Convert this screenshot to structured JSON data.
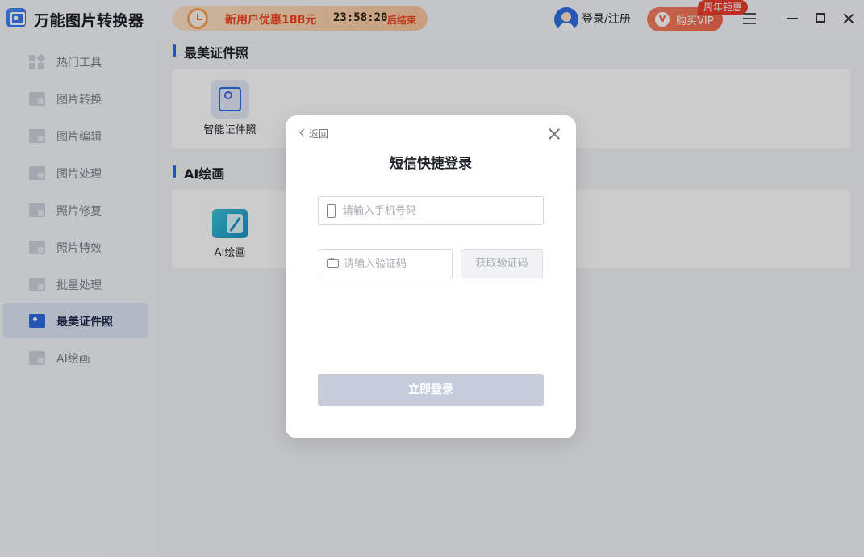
{
  "app": {
    "title": "万能图片转换器"
  },
  "promo": {
    "text": "新用户优惠188元",
    "timer": "23:58:20",
    "suffix": "后结束"
  },
  "header": {
    "login_label": "登录/注册",
    "vip_label": "购买VIP",
    "vip_badge": "周年钜惠"
  },
  "sidebar": {
    "items": [
      {
        "label": "热门工具",
        "icon": "grid-icon"
      },
      {
        "label": "图片转换",
        "icon": "image-convert-icon"
      },
      {
        "label": "图片编辑",
        "icon": "image-edit-icon"
      },
      {
        "label": "图片处理",
        "icon": "image-process-icon"
      },
      {
        "label": "照片修复",
        "icon": "photo-repair-icon"
      },
      {
        "label": "照片特效",
        "icon": "photo-effect-icon"
      },
      {
        "label": "批量处理",
        "icon": "batch-icon"
      },
      {
        "label": "最美证件照",
        "icon": "id-photo-icon",
        "active": true
      },
      {
        "label": "AI绘画",
        "icon": "ai-paint-icon"
      }
    ]
  },
  "main": {
    "sections": [
      {
        "title": "最美证件照",
        "tools": [
          {
            "label": "智能证件照"
          }
        ]
      },
      {
        "title": "AI绘画",
        "tools": [
          {
            "label": "AI绘画"
          }
        ]
      }
    ]
  },
  "modal": {
    "back_label": "返回",
    "title": "短信快捷登录",
    "phone_placeholder": "请输入手机号码",
    "code_placeholder": "请输入验证码",
    "get_code_label": "获取验证码",
    "submit_label": "立即登录"
  },
  "colors": {
    "accent": "#2e6bdf",
    "promo_red": "#f0421e",
    "vip": "#f06a4e",
    "submit_disabled": "#c6ccdc"
  }
}
